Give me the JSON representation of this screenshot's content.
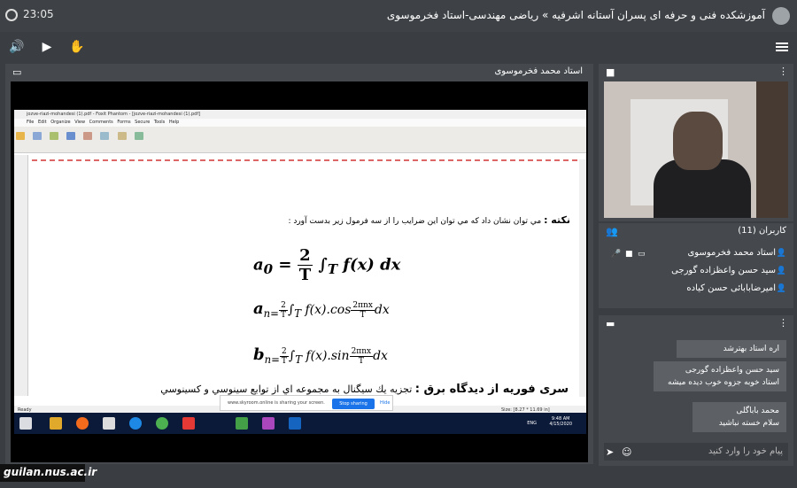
{
  "header": {
    "title": "آموزشکده فنی و حرفه ای پسران آستانه اشرفیه » ریاضی مهندسی-استاد فخرموسوی",
    "time": "23:05"
  },
  "screen_share": {
    "presenter": "استاد محمد فخرموسوی",
    "app_title": "jozve-riazi-mohandesi (1).pdf - Foxit Phantom - [jozve-riazi-mohandesi (1).pdf]",
    "menu": "File  Edit  Organize  View  Comments  Forms  Secure  Tools  Help",
    "note_label": "نکته :",
    "note_text": "مي توان نشان داد كه مي توان اين ضرايب را از سه فرمول زير بدست آورد :",
    "eq1": {
      "lhs": "a",
      "sub": "0",
      "num": "2",
      "den": "T",
      "tail": "f(x) dx"
    },
    "eq2": {
      "lhs": "a",
      "sub": "n=",
      "num": "2",
      "den": "T",
      "mid": "f(x).cos",
      "enum": "2πnx",
      "eden": "T",
      "tail": "dx"
    },
    "eq3": {
      "lhs": "b",
      "sub": "n=",
      "num": "2",
      "den": "T",
      "mid": "f(x).sin",
      "enum": "2πnx",
      "eden": "T",
      "tail": "dx"
    },
    "fourier_heading": "سری فوریه از دیدگاه برق :",
    "fourier_text": "تجزيه يك سيگنال به مجموعه اي از توابع سينوسي و كسينوسي",
    "status_left": "Ready",
    "status_right": "Size: [8.27 * 11.69 in]",
    "share_msg": "www.skyroom.online is sharing your screen.",
    "stop_label": "Stop sharing",
    "hide_label": "Hide",
    "taskbar_lang": "ENG",
    "taskbar_time": "9:48 AM",
    "taskbar_date": "4/15/2020"
  },
  "users": {
    "title": "کاربران (11)",
    "list": [
      "استاد محمد فخرموسوی",
      "سید حسن واعظزاده گورجی",
      "امیرضابابائی حسن کیاده"
    ]
  },
  "chat": {
    "messages": [
      {
        "author": "",
        "text": "اره استاد بهترشد"
      },
      {
        "author": "سید حسن واعظزاده گورجی",
        "text": "استاد خوبه جزوه خوب دیده میشه"
      },
      {
        "author": "محمد باباگلی",
        "text": "سلام خسته نباشید"
      }
    ],
    "placeholder": "پیام خود را وارد کنید"
  },
  "watermark": "guilan.nus.ac.ir"
}
